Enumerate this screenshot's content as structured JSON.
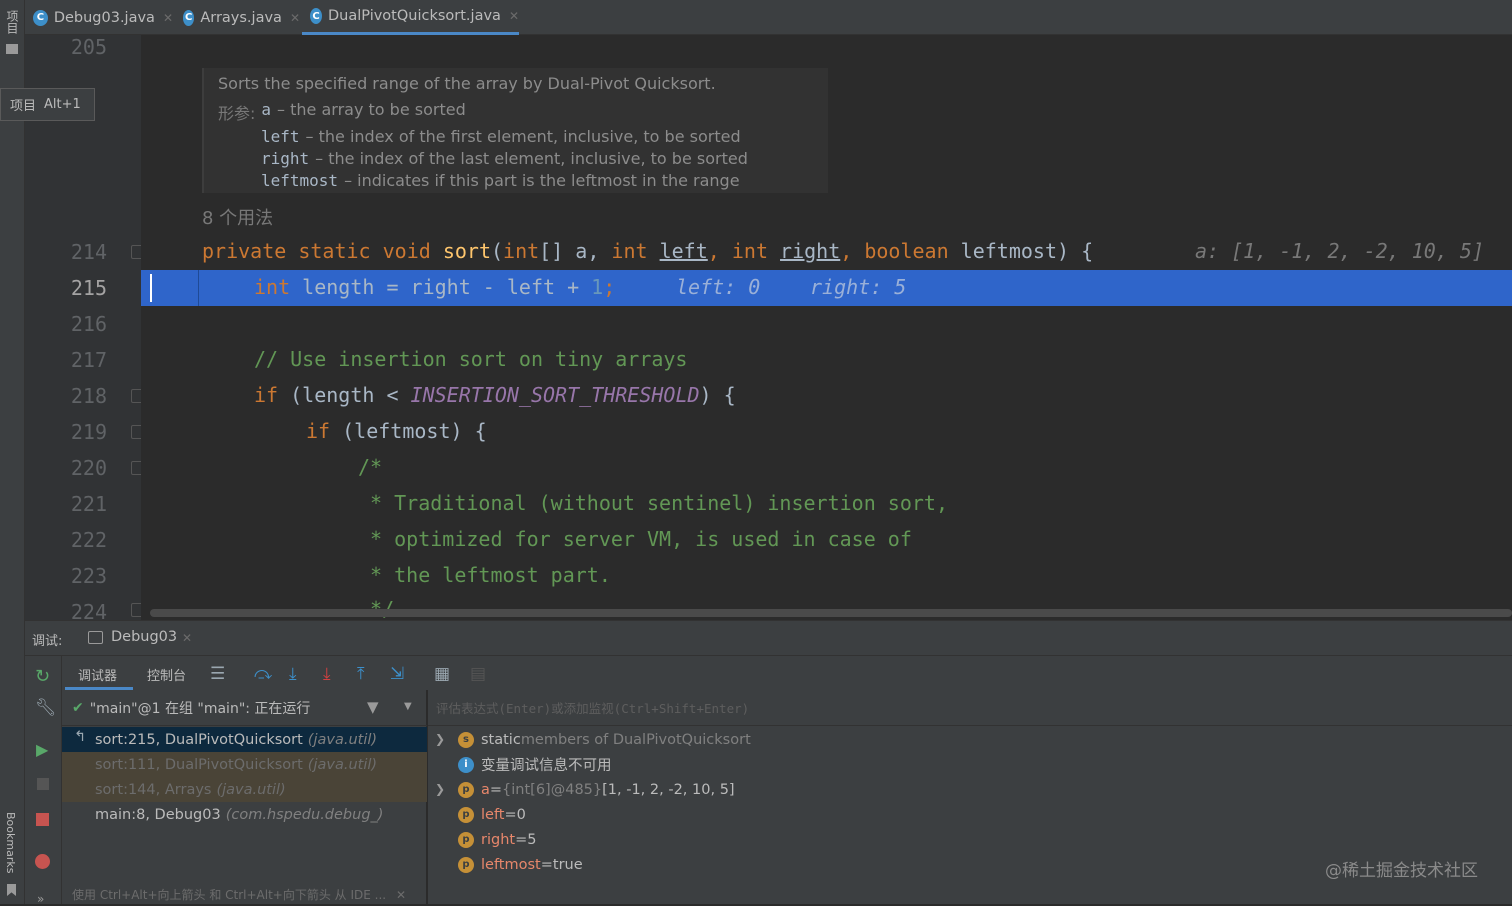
{
  "left_strip": {
    "project_label": "项目",
    "bookmarks_label": "Bookmarks"
  },
  "tabs": [
    {
      "label": "Debug03.java",
      "icon": "c"
    },
    {
      "label": "Arrays.java",
      "icon": "c"
    },
    {
      "label": "DualPivotQuicksort.java",
      "icon": "c"
    }
  ],
  "tooltip": {
    "text": "项目",
    "shortcut": "Alt+1"
  },
  "doc": {
    "summary": "Sorts the specified range of the array by Dual-Pivot Quicksort.",
    "params_label": "形参:",
    "params": [
      {
        "name": "a",
        "desc": "– the array to be sorted"
      },
      {
        "name": "left",
        "desc": "– the index of the first element, inclusive, to be sorted"
      },
      {
        "name": "right",
        "desc": "– the index of the last element, inclusive, to be sorted"
      },
      {
        "name": "leftmost",
        "desc": "– indicates if this part is the leftmost in the range"
      }
    ]
  },
  "usages": "8 个用法",
  "line_numbers": [
    "205",
    "214",
    "215",
    "216",
    "217",
    "218",
    "219",
    "220",
    "221",
    "222",
    "223",
    "224"
  ],
  "code": {
    "l214": {
      "kw1": "private static void ",
      "fn": "sort",
      "p1": "(",
      "t1": "int",
      "p2": "[] a, ",
      "t2": "int",
      "sp1": " ",
      "v1": "left",
      "p3": ", ",
      "t3": "int",
      "sp2": " ",
      "v2": "right",
      "p4": ", ",
      "t4": "boolean",
      "p5": " leftmost) {",
      "hint": "a: [1, -1, 2, -2, 10, 5]"
    },
    "l215": {
      "t": "int",
      "rest": " length = right - left + ",
      "num": "1",
      "semi": ";",
      "hint1": "left: 0",
      "hint2": "right: 5"
    },
    "l217": "// Use insertion sort on tiny arrays",
    "l218": {
      "kw": "if",
      "p1": " (length < ",
      "const": "INSERTION_SORT_THRESHOLD",
      "p2": ") {"
    },
    "l219": {
      "kw": "if",
      "p1": " (leftmost) {"
    },
    "l220": "/*",
    "l221": " * Traditional (without sentinel) insertion sort,",
    "l222": " * optimized for server VM, is used in case of",
    "l223": " * the leftmost part.",
    "l224": " */"
  },
  "debug": {
    "title_label": "调试:",
    "session": "Debug03",
    "tabs": [
      "调试器",
      "控制台"
    ],
    "thread": "\"main\"@1 在组 \"main\": 正在运行",
    "eval_placeholder": "评估表达式(Enter)或添加监视(Ctrl+Shift+Enter)",
    "frames": [
      {
        "text": "sort:215, DualPivotQuicksort",
        "pkg": "(java.util)"
      },
      {
        "text": "sort:111, DualPivotQuicksort",
        "pkg": "(java.util)"
      },
      {
        "text": "sort:144, Arrays",
        "pkg": "(java.util)"
      },
      {
        "text": "main:8, Debug03",
        "pkg": "(com.hspedu.debug_)"
      }
    ],
    "hint_bar": "使用 Ctrl+Alt+向上箭头 和 Ctrl+Alt+向下箭头 从 IDE ...",
    "vars": [
      {
        "badge": "s",
        "pre": "static",
        "name": "",
        "eq": "",
        "val": " members of DualPivotQuicksort"
      },
      {
        "badge": "i",
        "pre": "",
        "name": "",
        "eq": "",
        "val": "变量调试信息不可用"
      },
      {
        "badge": "p",
        "pre": "",
        "name": "a",
        "eq": " = ",
        "type": "{int[6]@485}",
        "val": " [1, -1, 2, -2, 10, 5]"
      },
      {
        "badge": "p",
        "pre": "",
        "name": "left",
        "eq": " = ",
        "val": "0"
      },
      {
        "badge": "p",
        "pre": "",
        "name": "right",
        "eq": " = ",
        "val": "5"
      },
      {
        "badge": "p",
        "pre": "",
        "name": "leftmost",
        "eq": " = ",
        "val": "true"
      }
    ]
  },
  "watermark": "@稀土掘金技术社区"
}
